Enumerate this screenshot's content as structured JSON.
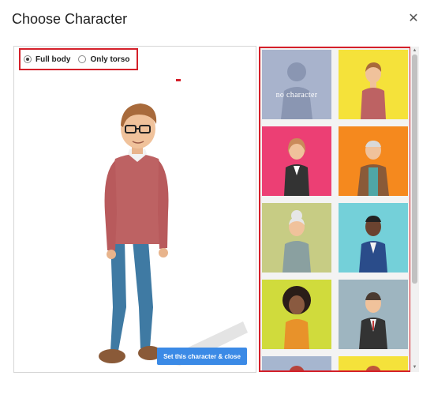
{
  "dialog": {
    "title": "Choose Character",
    "close_icon": "close-icon",
    "close_glyph": "✕"
  },
  "pose": {
    "options": [
      {
        "label": "Full body",
        "selected": true
      },
      {
        "label": "Only torso",
        "selected": false
      }
    ]
  },
  "preview": {
    "action_button": "Set this character & close"
  },
  "gallery": {
    "tiles": [
      {
        "label": "no character",
        "bg": "#a8b3cc"
      },
      {
        "label": "",
        "bg": "#f5e23a"
      },
      {
        "label": "",
        "bg": "#ec3f74"
      },
      {
        "label": "",
        "bg": "#f5891e"
      },
      {
        "label": "",
        "bg": "#c7cc84"
      },
      {
        "label": "",
        "bg": "#74d0d9"
      },
      {
        "label": "",
        "bg": "#d0db3c"
      },
      {
        "label": "",
        "bg": "#9eb5c0"
      },
      {
        "label": "",
        "bg": "#a6b6cf"
      },
      {
        "label": "",
        "bg": "#f5e23a"
      }
    ]
  },
  "colors": {
    "accent": "#3b8ae6",
    "highlight_border": "#d4202a"
  }
}
